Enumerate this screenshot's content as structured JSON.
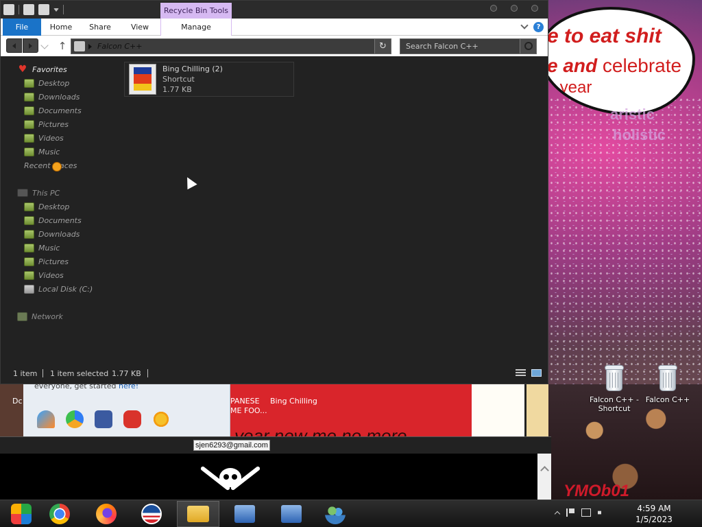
{
  "explorer": {
    "contextual_tab_group": "Recycle Bin Tools",
    "ribbon_tabs": {
      "file": "File",
      "home": "Home",
      "share": "Share",
      "view": "View",
      "manage": "Manage"
    },
    "help_icon": "?",
    "address": {
      "path": "Falcon C++",
      "refresh_icon": "↻"
    },
    "search": {
      "placeholder": "Search Falcon C++"
    },
    "up_icon": "↑",
    "nav": {
      "favorites": {
        "label": "Favorites",
        "items": [
          "Desktop",
          "Downloads",
          "Documents",
          "Pictures",
          "Videos",
          "Music",
          "Recent places"
        ]
      },
      "this_pc": {
        "label": "This PC",
        "items": [
          "Desktop",
          "Documents",
          "Downloads",
          "Music",
          "Pictures",
          "Videos",
          "Local Disk (C:)"
        ]
      },
      "network": "Network"
    },
    "items": [
      {
        "name": "Bing Chilling (2)",
        "type": "Shortcut",
        "size": "1.77 KB"
      }
    ],
    "status": {
      "count": "1 item",
      "selected": "1 item selected",
      "size": "1.77 KB"
    }
  },
  "desktop": {
    "wallpaper_text": {
      "line1": "e to eat shit",
      "line2_bold": "e and",
      "line2_rest": "celebrate",
      "line3": "y year",
      "overlay1": "aristic",
      "overlay2": "holistic"
    },
    "watermark": "YMOb01",
    "icons": [
      {
        "label": "Falcon C++ - Shortcut"
      },
      {
        "label": "Falcon C++"
      }
    ]
  },
  "background_window": {
    "left_label": "Dc",
    "hint_prefix": "everyone, get started",
    "hint_link": "here!",
    "label1_line1": "PANESE",
    "label1_line2": "ME FOO...",
    "label2": "Bing Chilling",
    "caption": "year new me no more"
  },
  "browser": {
    "email": "sjen6293@gmail.com"
  },
  "taskbar": {
    "apps": [
      "media-center",
      "chrome",
      "firefox",
      "campaign-logo",
      "file-explorer",
      "remote-desktop-1",
      "remote-desktop-2",
      "users"
    ],
    "time": "4:59 AM",
    "date": "1/5/2023"
  }
}
